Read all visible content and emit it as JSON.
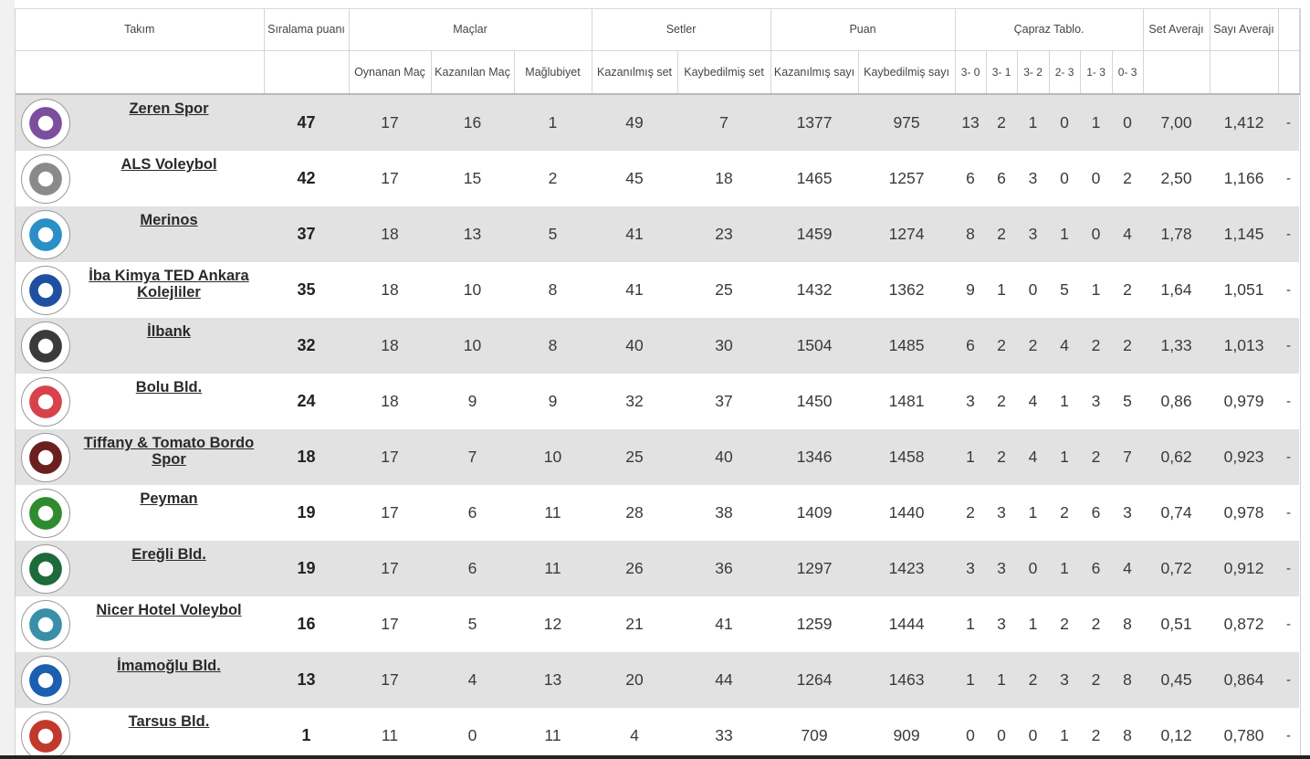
{
  "headers": {
    "takim": "Takım",
    "siralama": "Sıralama puanı",
    "maclar": "Maçlar",
    "setler": "Setler",
    "puan": "Puan",
    "capraz": "Çapraz Tablo.",
    "set_averaji": "Set Averajı",
    "sayi_averaji": "Sayı Averajı",
    "oynanan": "Oynanan Maç",
    "kazanilan": "Kazanılan Maç",
    "maglubiyet": "Mağlubiyet",
    "kazanilmis_set": "Kazanılmış set",
    "kaybedilmis_set": "Kaybedilmiş set",
    "kazanilmis_sayi": "Kazanılmış sayı",
    "kaybedilmis_sayi": "Kaybedilmiş sayı",
    "c30": "3- 0",
    "c31": "3- 1",
    "c32": "3- 2",
    "c23": "2- 3",
    "c13": "1- 3",
    "c03": "0- 3"
  },
  "rows": [
    {
      "team": "Zeren Spor",
      "pts": "47",
      "played": "17",
      "won": "16",
      "lost": "1",
      "sw": "49",
      "sl": "7",
      "pw": "1377",
      "pl": "975",
      "c30": "13",
      "c31": "2",
      "c32": "1",
      "c23": "0",
      "c13": "1",
      "c03": "0",
      "savg": "7,00",
      "pavg": "1,412",
      "extra": "-",
      "logo_color": "#7b4f9e",
      "logo_icon": "zeren-logo-icon"
    },
    {
      "team": "ALS Voleybol",
      "pts": "42",
      "played": "17",
      "won": "15",
      "lost": "2",
      "sw": "45",
      "sl": "18",
      "pw": "1465",
      "pl": "1257",
      "c30": "6",
      "c31": "6",
      "c32": "3",
      "c23": "0",
      "c13": "0",
      "c03": "2",
      "savg": "2,50",
      "pavg": "1,166",
      "extra": "-",
      "logo_color": "#8a8a8a",
      "logo_icon": "als-logo-icon"
    },
    {
      "team": "Merinos",
      "pts": "37",
      "played": "18",
      "won": "13",
      "lost": "5",
      "sw": "41",
      "sl": "23",
      "pw": "1459",
      "pl": "1274",
      "c30": "8",
      "c31": "2",
      "c32": "3",
      "c23": "1",
      "c13": "0",
      "c03": "4",
      "savg": "1,78",
      "pavg": "1,145",
      "extra": "-",
      "logo_color": "#2a8fc7",
      "logo_icon": "merinos-logo-icon"
    },
    {
      "team": "İba Kimya TED Ankara Kolejliler",
      "pts": "35",
      "played": "18",
      "won": "10",
      "lost": "8",
      "sw": "41",
      "sl": "25",
      "pw": "1432",
      "pl": "1362",
      "c30": "9",
      "c31": "1",
      "c32": "0",
      "c23": "5",
      "c13": "1",
      "c03": "2",
      "savg": "1,64",
      "pavg": "1,051",
      "extra": "-",
      "logo_color": "#1f4fa0",
      "logo_icon": "ted-logo-icon"
    },
    {
      "team": "İlbank",
      "pts": "32",
      "played": "18",
      "won": "10",
      "lost": "8",
      "sw": "40",
      "sl": "30",
      "pw": "1504",
      "pl": "1485",
      "c30": "6",
      "c31": "2",
      "c32": "2",
      "c23": "4",
      "c13": "2",
      "c03": "2",
      "savg": "1,33",
      "pavg": "1,013",
      "extra": "-",
      "logo_color": "#3a3a3a",
      "logo_icon": "ilbank-logo-icon"
    },
    {
      "team": "Bolu Bld.",
      "pts": "24",
      "played": "18",
      "won": "9",
      "lost": "9",
      "sw": "32",
      "sl": "37",
      "pw": "1450",
      "pl": "1481",
      "c30": "3",
      "c31": "2",
      "c32": "4",
      "c23": "1",
      "c13": "3",
      "c03": "5",
      "savg": "0,86",
      "pavg": "0,979",
      "extra": "-",
      "logo_color": "#d8424a",
      "logo_icon": "bolu-logo-icon"
    },
    {
      "team": "Tiffany & Tomato Bordo Spor",
      "pts": "18",
      "played": "17",
      "won": "7",
      "lost": "10",
      "sw": "25",
      "sl": "40",
      "pw": "1346",
      "pl": "1458",
      "c30": "1",
      "c31": "2",
      "c32": "4",
      "c23": "1",
      "c13": "2",
      "c03": "7",
      "savg": "0,62",
      "pavg": "0,923",
      "extra": "-",
      "logo_color": "#6b1f1f",
      "logo_icon": "tiffany-logo-icon"
    },
    {
      "team": "Peyman",
      "pts": "19",
      "played": "17",
      "won": "6",
      "lost": "11",
      "sw": "28",
      "sl": "38",
      "pw": "1409",
      "pl": "1440",
      "c30": "2",
      "c31": "3",
      "c32": "1",
      "c23": "2",
      "c13": "6",
      "c03": "3",
      "savg": "0,74",
      "pavg": "0,978",
      "extra": "-",
      "logo_color": "#2e8b2e",
      "logo_icon": "peyman-logo-icon"
    },
    {
      "team": "Ereğli Bld.",
      "pts": "19",
      "played": "17",
      "won": "6",
      "lost": "11",
      "sw": "26",
      "sl": "36",
      "pw": "1297",
      "pl": "1423",
      "c30": "3",
      "c31": "3",
      "c32": "0",
      "c23": "1",
      "c13": "6",
      "c03": "4",
      "savg": "0,72",
      "pavg": "0,912",
      "extra": "-",
      "logo_color": "#1d6b3a",
      "logo_icon": "eregli-logo-icon"
    },
    {
      "team": "Nicer Hotel Voleybol",
      "pts": "16",
      "played": "17",
      "won": "5",
      "lost": "12",
      "sw": "21",
      "sl": "41",
      "pw": "1259",
      "pl": "1444",
      "c30": "1",
      "c31": "3",
      "c32": "1",
      "c23": "2",
      "c13": "2",
      "c03": "8",
      "savg": "0,51",
      "pavg": "0,872",
      "extra": "-",
      "logo_color": "#3a8fa8",
      "logo_icon": "nicer-logo-icon"
    },
    {
      "team": "İmamoğlu Bld.",
      "pts": "13",
      "played": "17",
      "won": "4",
      "lost": "13",
      "sw": "20",
      "sl": "44",
      "pw": "1264",
      "pl": "1463",
      "c30": "1",
      "c31": "1",
      "c32": "2",
      "c23": "3",
      "c13": "2",
      "c03": "8",
      "savg": "0,45",
      "pavg": "0,864",
      "extra": "-",
      "logo_color": "#1c5fb0",
      "logo_icon": "imamoglu-logo-icon"
    },
    {
      "team": "Tarsus Bld.",
      "pts": "1",
      "played": "11",
      "won": "0",
      "lost": "11",
      "sw": "4",
      "sl": "33",
      "pw": "709",
      "pl": "909",
      "c30": "0",
      "c31": "0",
      "c32": "0",
      "c23": "1",
      "c13": "2",
      "c03": "8",
      "savg": "0,12",
      "pavg": "0,780",
      "extra": "-",
      "logo_color": "#c0392b",
      "logo_icon": "tarsus-logo-icon"
    }
  ]
}
